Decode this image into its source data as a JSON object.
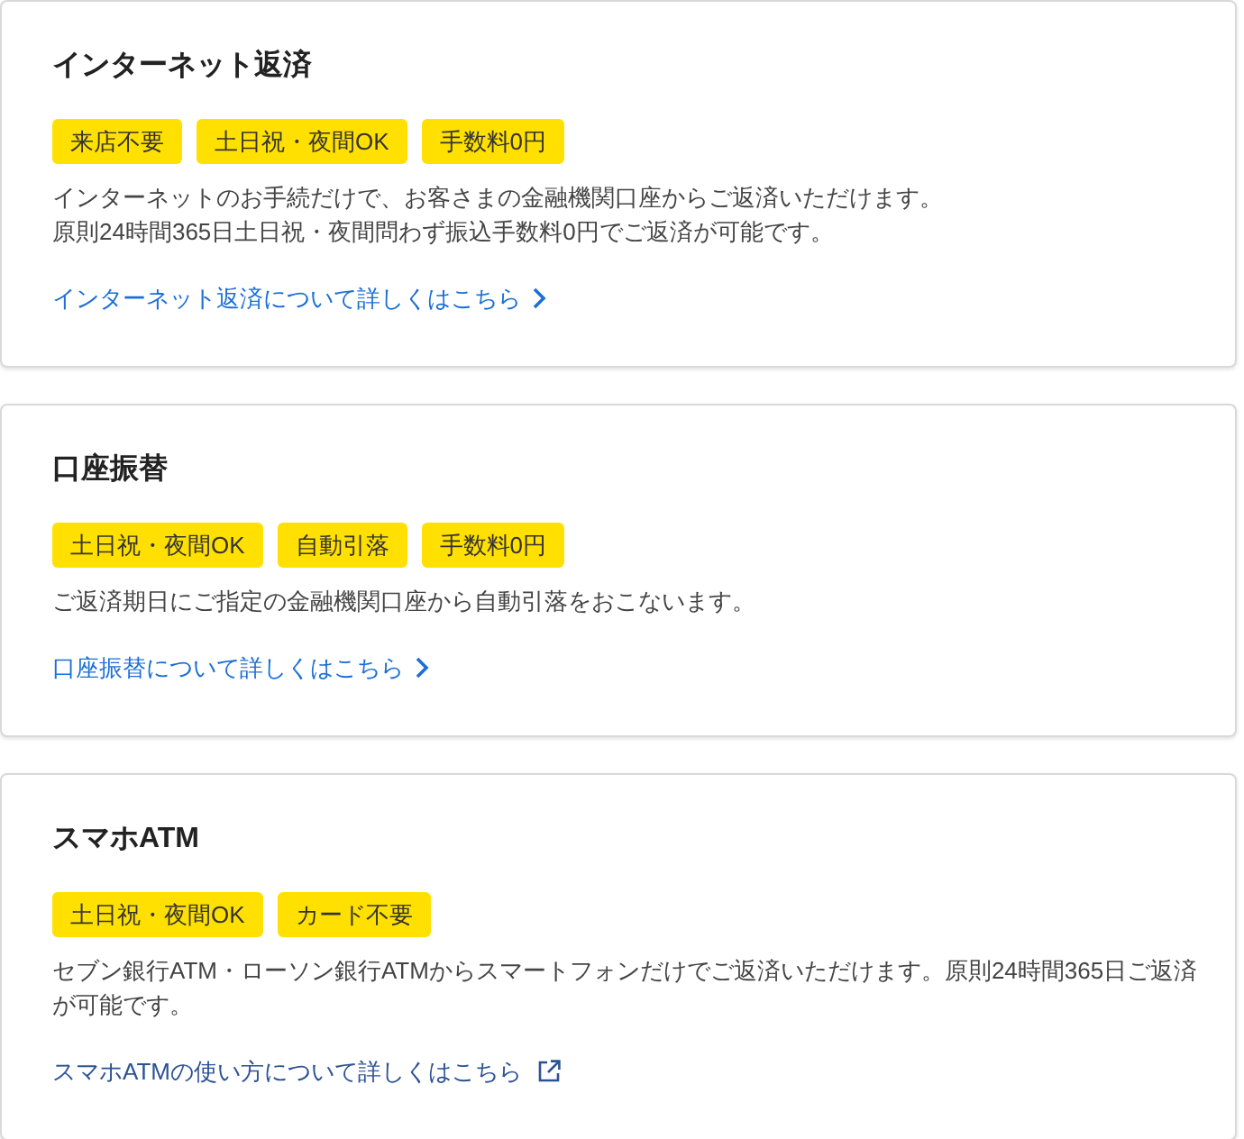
{
  "cards": [
    {
      "title": "インターネット返済",
      "tags": [
        "来店不要",
        "土日祝・夜間OK",
        "手数料0円"
      ],
      "description": [
        "インターネットのお手続だけで、お客さまの金融機関口座からご返済いただけます。",
        "原則24時間365日土日祝・夜間問わず振込手数料0円でご返済が可能です。"
      ],
      "link": {
        "text": "インターネット返済について詳しくはこちら",
        "kind": "internal"
      }
    },
    {
      "title": "口座振替",
      "tags": [
        "土日祝・夜間OK",
        "自動引落",
        "手数料0円"
      ],
      "description": [
        "ご返済期日にご指定の金融機関口座から自動引落をおこないます。"
      ],
      "link": {
        "text": "口座振替について詳しくはこちら",
        "kind": "internal"
      }
    },
    {
      "title": "スマホATM",
      "tags": [
        "土日祝・夜間OK",
        "カード不要"
      ],
      "description": [
        "セブン銀行ATM・ローソン銀行ATMからスマートフォンだけでご返済いただけます。原則24時間365日ご返済が可能です。"
      ],
      "link": {
        "text": "スマホATMの使い方について詳しくはこちら",
        "kind": "external"
      }
    }
  ]
}
